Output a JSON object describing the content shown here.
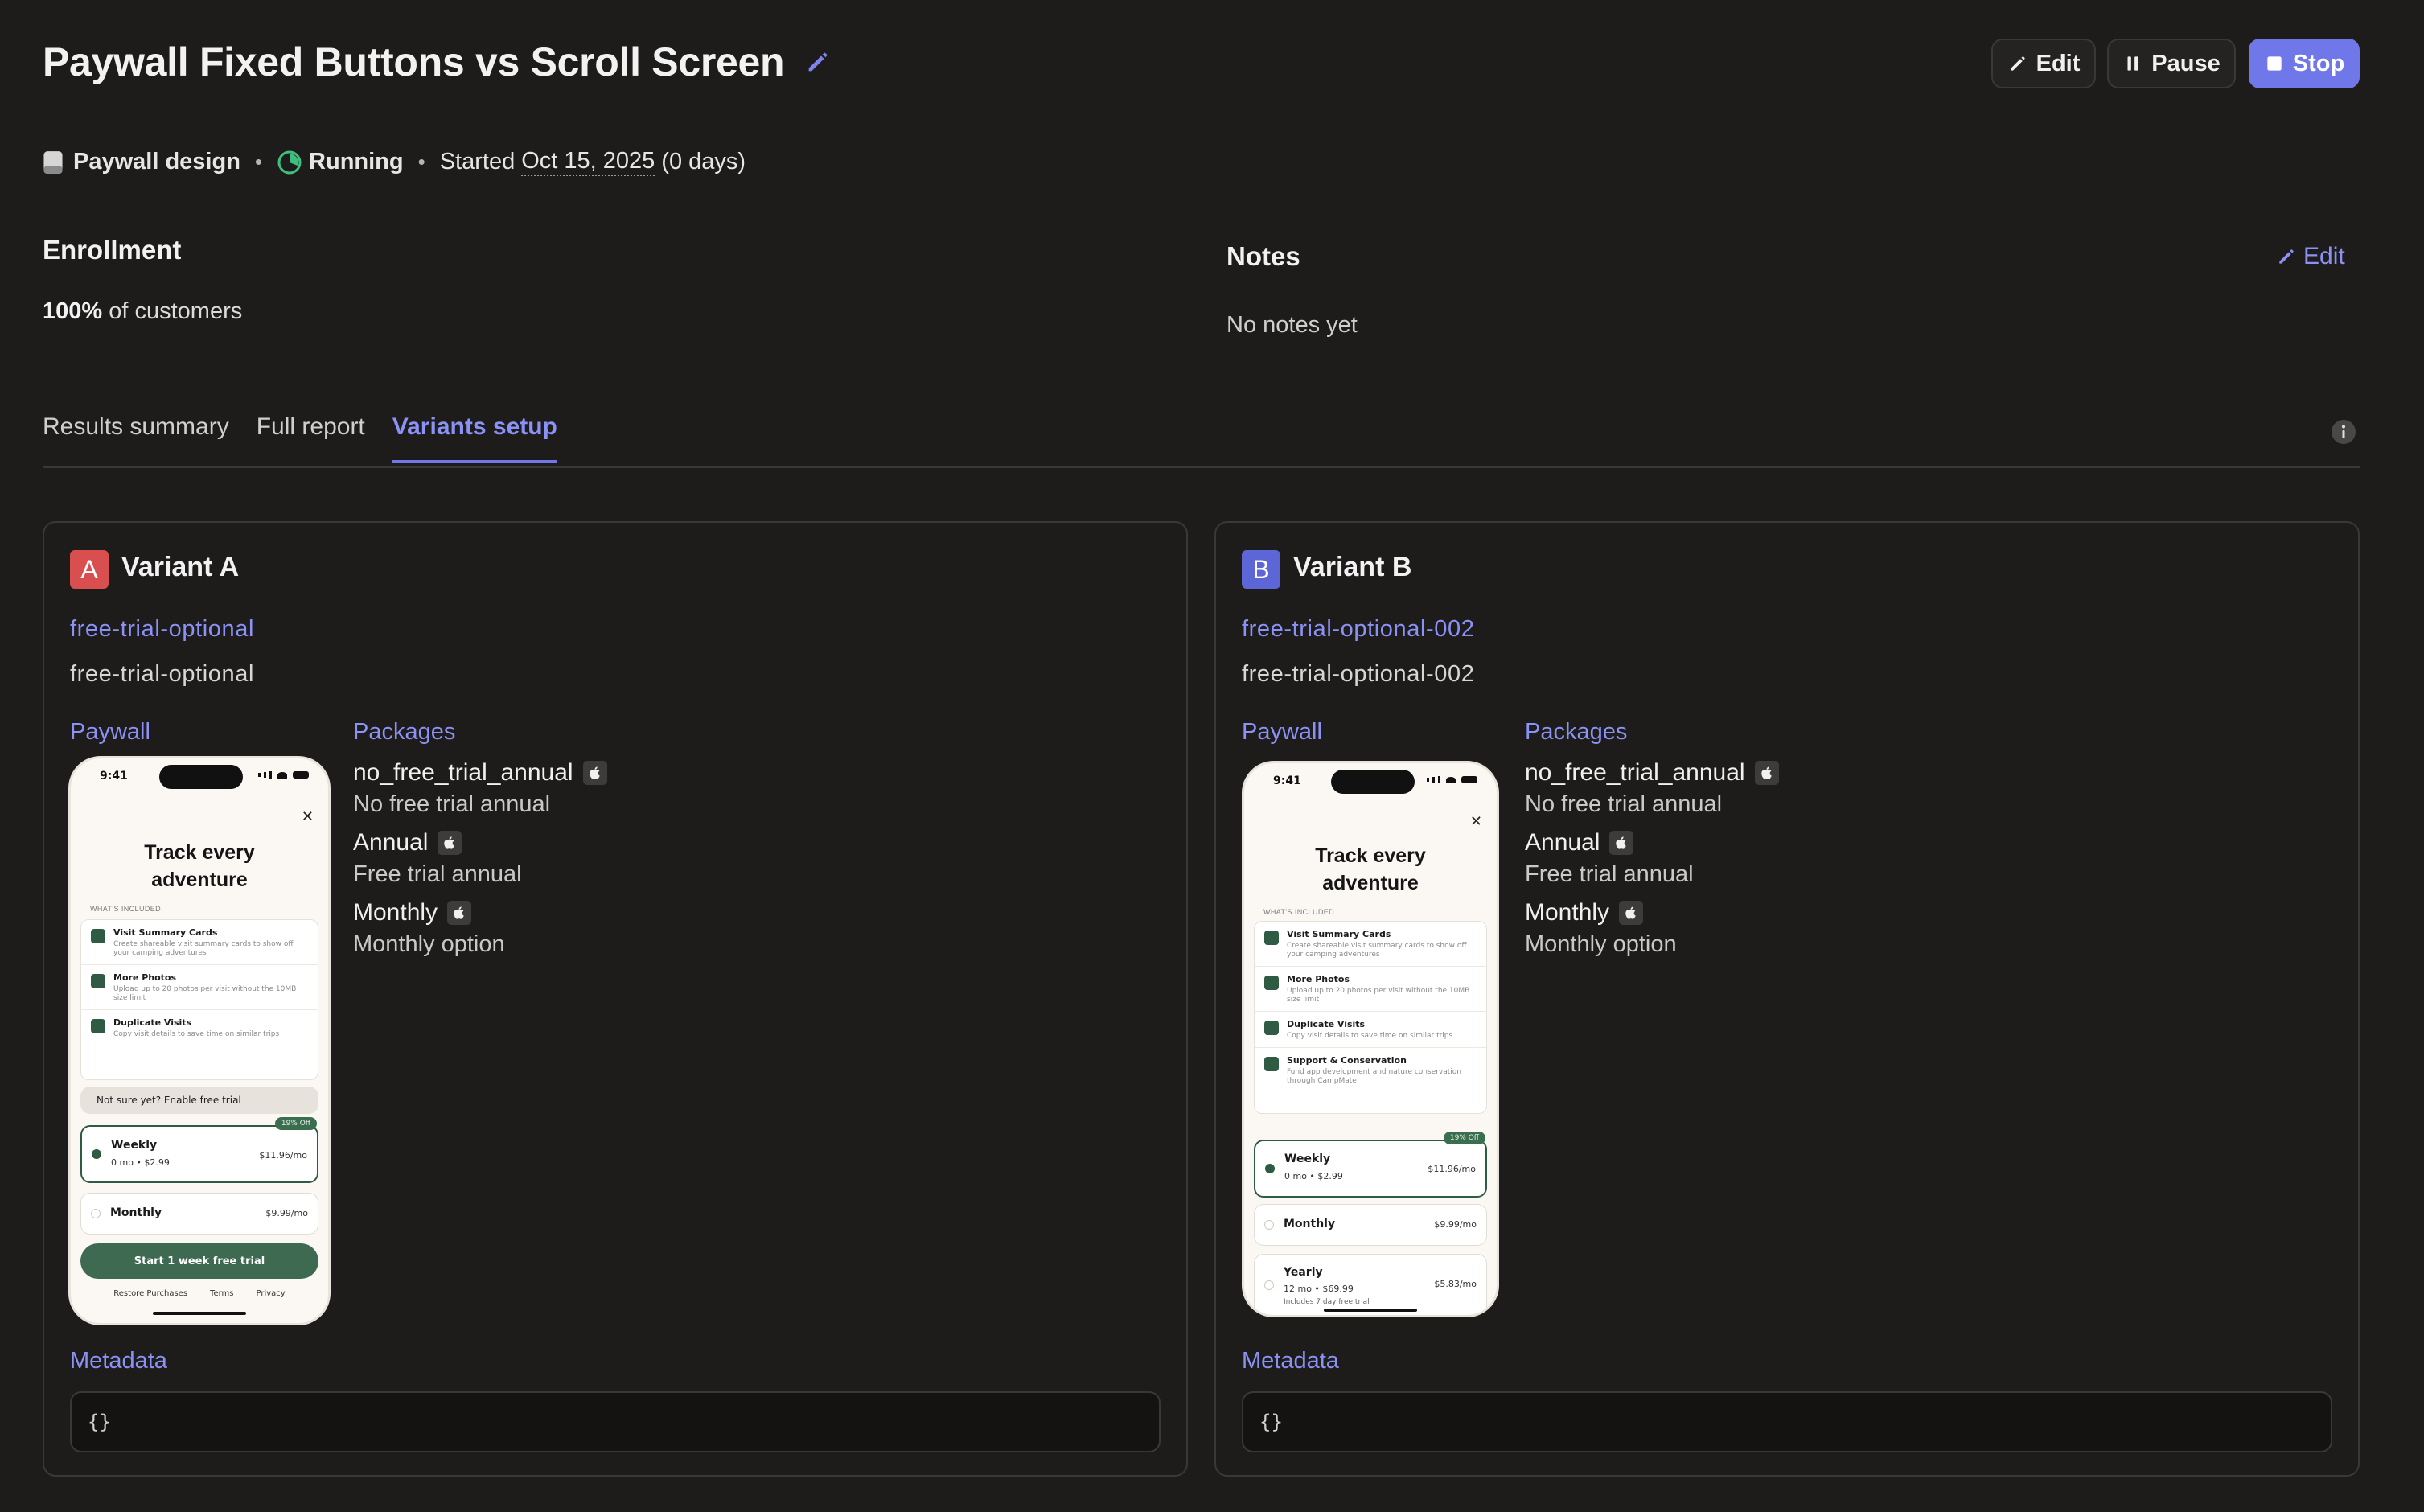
{
  "header": {
    "title": "Paywall Fixed Buttons vs Scroll Screen",
    "edit_label": "Edit",
    "pause_label": "Pause",
    "stop_label": "Stop"
  },
  "meta": {
    "placement": "Paywall design",
    "status": "Running",
    "started_prefix": "Started",
    "started_date": "Oct 15, 2025",
    "duration": "(0 days)"
  },
  "enrollment": {
    "title": "Enrollment",
    "percent": "100%",
    "suffix": "of customers"
  },
  "notes": {
    "title": "Notes",
    "edit_label": "Edit",
    "empty_text": "No notes yet"
  },
  "tabs": [
    {
      "label": "Results summary",
      "active": false
    },
    {
      "label": "Full report",
      "active": false
    },
    {
      "label": "Variants setup",
      "active": true
    }
  ],
  "labels": {
    "paywall": "Paywall",
    "packages": "Packages",
    "metadata": "Metadata"
  },
  "variants": [
    {
      "letter": "A",
      "name": "Variant A",
      "offering_link": "free-trial-optional",
      "offering_desc": "free-trial-optional",
      "packages": [
        {
          "name": "no_free_trial_annual",
          "desc": "No free trial annual"
        },
        {
          "name": "Annual",
          "desc": "Free trial annual"
        },
        {
          "name": "Monthly",
          "desc": "Monthly option"
        }
      ],
      "metadata": "{}",
      "phone": {
        "time": "9:41",
        "headline_1": "Track every",
        "headline_2": "adventure",
        "section": "WHAT'S INCLUDED",
        "features": [
          {
            "title": "Visit Summary Cards",
            "desc": "Create shareable visit summary cards to show off your camping adventures"
          },
          {
            "title": "More Photos",
            "desc": "Upload up to 20 photos per visit without the 10MB size limit"
          },
          {
            "title": "Duplicate Visits",
            "desc": "Copy visit details to save time on similar trips"
          }
        ],
        "trial_toggle": "Not sure yet? Enable free trial",
        "options": [
          {
            "name": "Weekly",
            "sub": "0 mo • $2.99",
            "price": "$11.96/mo",
            "tag": "19% Off"
          },
          {
            "name": "Monthly",
            "sub": "",
            "price": "$9.99/mo",
            "tag": ""
          }
        ],
        "cta": "Start 1 week free trial",
        "footer": [
          "Restore Purchases",
          "Terms",
          "Privacy"
        ]
      }
    },
    {
      "letter": "B",
      "name": "Variant B",
      "offering_link": "free-trial-optional-002",
      "offering_desc": "free-trial-optional-002",
      "packages": [
        {
          "name": "no_free_trial_annual",
          "desc": "No free trial annual"
        },
        {
          "name": "Annual",
          "desc": "Free trial annual"
        },
        {
          "name": "Monthly",
          "desc": "Monthly option"
        }
      ],
      "metadata": "{}",
      "phone": {
        "time": "9:41",
        "headline_1": "Track every",
        "headline_2": "adventure",
        "section": "WHAT'S INCLUDED",
        "features": [
          {
            "title": "Visit Summary Cards",
            "desc": "Create shareable visit summary cards to show off your camping adventures"
          },
          {
            "title": "More Photos",
            "desc": "Upload up to 20 photos per visit without the 10MB size limit"
          },
          {
            "title": "Duplicate Visits",
            "desc": "Copy visit details to save time on similar trips"
          },
          {
            "title": "Support & Conservation",
            "desc": "Fund app development and nature conservation through CampMate"
          }
        ],
        "options": [
          {
            "name": "Weekly",
            "sub": "0 mo • $2.99",
            "price": "$11.96/mo",
            "tag": "19% Off"
          },
          {
            "name": "Monthly",
            "sub": "",
            "price": "$9.99/mo",
            "tag": ""
          },
          {
            "name": "Yearly",
            "sub": "12 mo • $69.99",
            "sub2": "Includes 7 day free trial",
            "price": "$5.83/mo",
            "tag": ""
          }
        ]
      }
    }
  ],
  "colors": {
    "background": "#1e1c1b",
    "accent": "#7077e8",
    "link": "#8b92f5",
    "variant_a": "#d94f4f",
    "variant_b": "#5c66d6",
    "running": "#3fbf7f"
  }
}
